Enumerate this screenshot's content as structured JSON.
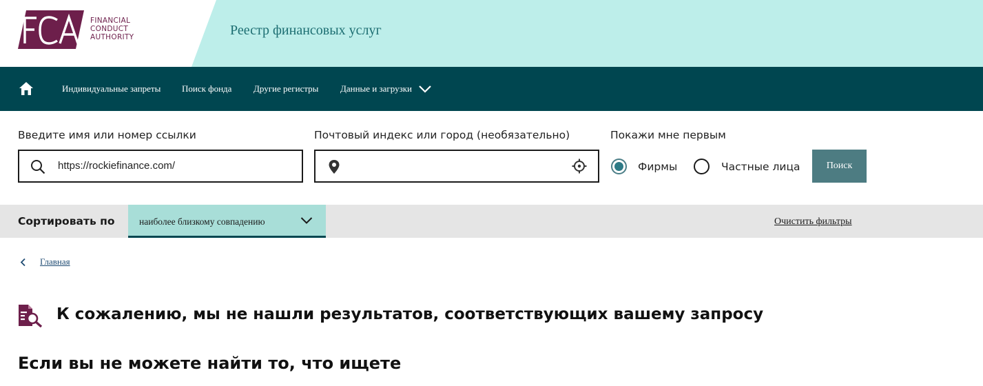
{
  "header": {
    "logo_letters": "FCA",
    "logo_name_lines": [
      "FINANCIAL",
      "CONDUCT",
      "AUTHORITY"
    ],
    "site_title": "Реестр финансовых услуг"
  },
  "nav": {
    "home_icon": "home-icon",
    "items": [
      {
        "label": "Индивидуальные запреты"
      },
      {
        "label": "Поиск фонда"
      },
      {
        "label": "Другие регистры"
      },
      {
        "label": "Данные и загрузки"
      }
    ]
  },
  "search": {
    "name_label": "Введите имя или номер ссылки",
    "name_value": "https://rockiefinance.com/",
    "location_label": "Почтовый индекс или город (необязательно)",
    "location_value": "",
    "show_first_label": "Покажи мне первым",
    "options": [
      {
        "label": "Фирмы",
        "selected": true
      },
      {
        "label": "Частные лица",
        "selected": false
      }
    ],
    "button_label": "Поиск"
  },
  "sort": {
    "label": "Сортировать по",
    "selected": "наиболее близкому совпадению",
    "clear_label": "Очистить фильтры"
  },
  "breadcrumb": {
    "home": "Главная"
  },
  "results": {
    "no_results_title": "К сожалению, мы не нашли результатов, соответствующих вашему запросу",
    "help_title": "Если вы не можете найти то, что ищете"
  },
  "colors": {
    "header_bg": "#bdeeea",
    "brand": "#6d1f4b",
    "nav_bg": "#004650",
    "button": "#4d7c82",
    "sort_select": "#a8ded8"
  }
}
